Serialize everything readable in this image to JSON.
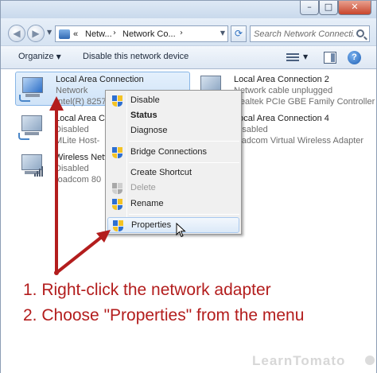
{
  "window": {
    "controls": {
      "minimize": "–",
      "maximize": "□",
      "close": "✕"
    }
  },
  "navbar": {
    "back_icon": "back-arrow-icon",
    "forward_icon": "forward-arrow-icon",
    "breadcrumb_overflow": "«",
    "breadcrumbs": [
      "Netw...",
      "Network Co..."
    ],
    "search_placeholder": "Search Network Connecti..."
  },
  "toolbar": {
    "organize_label": "Organize",
    "disable_label": "Disable this network device"
  },
  "adapters": [
    {
      "name": "Local Area Connection",
      "status": "Network",
      "device": "Intel(R) 82579",
      "selected": true
    },
    {
      "name": "Local Area Connection 2",
      "status": "Network cable unplugged",
      "device": "Realtek PCIe GBE Family Controller"
    },
    {
      "name": "Local Area Co",
      "status": "Disabled",
      "device": "MLite Host-"
    },
    {
      "name": "Local Area Connection 4",
      "status": "Disabled",
      "device": "roadcom Virtual Wireless Adapter"
    },
    {
      "name": "Wireless Netw",
      "status": "Disabled",
      "device": "roadcom 80"
    }
  ],
  "context_menu": {
    "items": [
      {
        "label": "Disable",
        "icon": "uac-shield-icon"
      },
      {
        "label": "Status"
      },
      {
        "label": "Diagnose"
      },
      {
        "label": "Bridge Connections",
        "icon": "uac-shield-icon"
      },
      {
        "label": "Create Shortcut"
      },
      {
        "label": "Delete",
        "icon": "uac-shield-icon",
        "disabled": true
      },
      {
        "label": "Rename",
        "icon": "uac-shield-icon"
      },
      {
        "label": "Properties",
        "icon": "uac-shield-icon",
        "highlighted": true
      }
    ]
  },
  "instructions": [
    "1. Right-click the network adapter",
    "2. Choose \"Properties\" from the menu"
  ],
  "watermark": "LearnTomato",
  "colors": {
    "annotation": "#b31d1d",
    "selection": "#cfe3f8"
  }
}
